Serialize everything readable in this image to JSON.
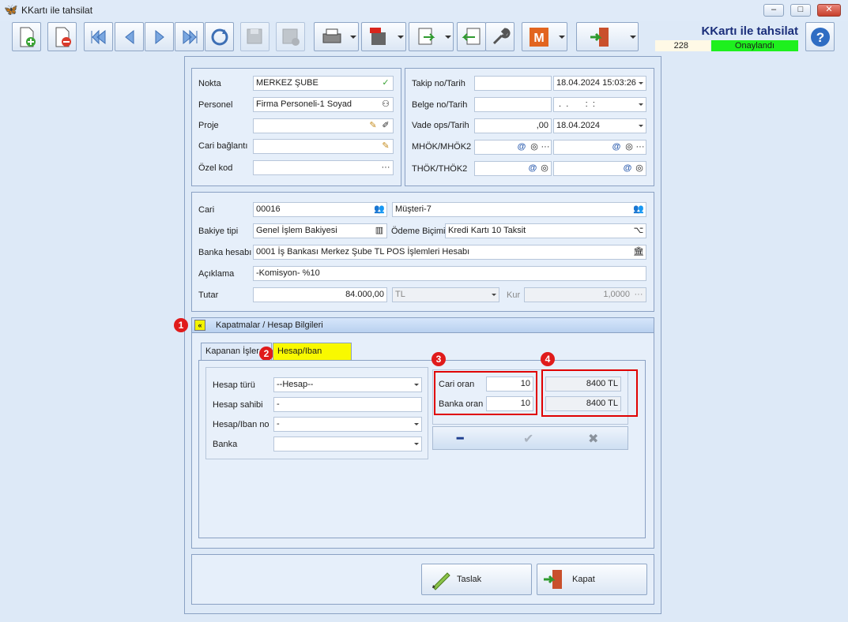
{
  "window": {
    "title": "KKartı ile tahsilat",
    "minimize": "–",
    "maximize": "□",
    "close": "✕"
  },
  "header": {
    "title": "KKartı ile tahsilat",
    "number": "228",
    "status": "Onaylandı",
    "status_color": "#1ef01e"
  },
  "toolbar": {
    "icons": [
      "new-doc",
      "delete-doc",
      "first",
      "prev",
      "next",
      "last",
      "refresh",
      "save-disabled",
      "cancel-disabled",
      "print",
      "pdf-save",
      "export",
      "import",
      "tools",
      "m-module",
      "exit"
    ]
  },
  "left_panel": {
    "nokta_label": "Nokta",
    "nokta_value": "MERKEZ ŞUBE",
    "personel_label": "Personel",
    "personel_value": "Firma Personeli-1 Soyad",
    "proje_label": "Proje",
    "proje_value": "",
    "cari_baglanti_label": "Cari bağlantı",
    "cari_baglanti_value": "",
    "ozel_kod_label": "Özel kod",
    "ozel_kod_value": "",
    "ellipsis": "···"
  },
  "right_panel": {
    "takip_label": "Takip no/Tarih",
    "takip_no": "",
    "takip_tarih": "18.04.2024 15:03:26",
    "belge_label": "Belge no/Tarih",
    "belge_no": "",
    "belge_tarih": " .  .       :  :",
    "vade_label": "Vade ops/Tarih",
    "vade_ops": ",00",
    "vade_tarih": "18.04.2024",
    "mhok_label": "MHÖK/MHÖK2",
    "thok_label": "THÖK/THÖK2",
    "at": "@"
  },
  "cari_panel": {
    "cari_label": "Cari",
    "cari_kod": "00016",
    "cari_ad": "Müşteri-7",
    "bakiye_label": "Bakiye tipi",
    "bakiye_value": "Genel İşlem Bakiyesi",
    "odeme_label": "Ödeme Biçimi",
    "odeme_value": "Kredi Kartı 10 Taksit",
    "banka_label": "Banka hesabı",
    "banka_value": "0001 İş Bankası Merkez Şube TL POS İşlemleri Hesabı",
    "aciklama_label": "Açıklama",
    "aciklama_value": "-Komisyon- %10",
    "tutar_label": "Tutar",
    "tutar_value": "84.000,00",
    "doviz_value": "TL",
    "kur_label": "Kur",
    "kur_value": "1,0000"
  },
  "section": {
    "title": "Kapatmalar / Hesap Bilgileri",
    "expand_glyph": "«"
  },
  "badges": [
    "1",
    "2",
    "3",
    "4"
  ],
  "tabs": [
    {
      "label": "Kapanan İşler"
    },
    {
      "label": "Hesap/Iban Bilgileri"
    }
  ],
  "hesap": {
    "turu_label": "Hesap türü",
    "turu_value": "--Hesap--",
    "sahibi_label": "Hesap sahibi",
    "sahibi_value": "-",
    "iban_label": "Hesap/Iban no",
    "iban_value": "-",
    "banka_label": "Banka",
    "banka_value": ""
  },
  "oran": {
    "cari_label": "Cari oran",
    "cari_value": "10",
    "cari_tutar": "8400 TL",
    "banka_label": "Banka oran",
    "banka_value": "10",
    "banka_tutar": "8400 TL"
  },
  "actions": {
    "minus": "━",
    "check": "✔",
    "cross": "✖"
  },
  "buttons": {
    "taslak": "Taslak",
    "kapat": "Kapat"
  }
}
